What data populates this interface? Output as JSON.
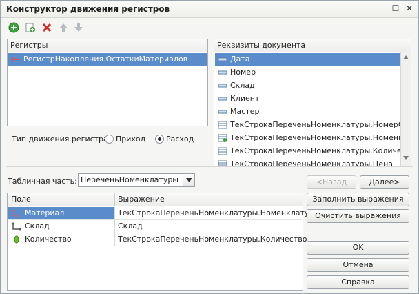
{
  "window": {
    "title": "Конструктор движения регистров",
    "restore_glyph": "☐",
    "close_glyph": "✕"
  },
  "toolbar": {
    "icons": [
      "add-icon",
      "copy-add-icon",
      "delete-icon",
      "move-up-icon",
      "move-down-icon"
    ]
  },
  "registers": {
    "header": "Регистры",
    "items": [
      "РегистрНакопления.ОстаткиМатериалов"
    ]
  },
  "attributes": {
    "header": "Реквизиты документа",
    "items": [
      "Дата",
      "Номер",
      "Склад",
      "Клиент",
      "Мастер",
      "ТекСтрокаПереченьНоменклатуры.НомерСт...",
      "ТекСтрокаПереченьНоменклатуры.Номенкл...",
      "ТекСтрокаПереченьНоменклатуры.Количест...",
      "ТекСтрокаПереченьНоменклатуры.Цена"
    ],
    "selected_index": 0
  },
  "movement": {
    "label": "Тип движения регистра:",
    "options": [
      "Приход",
      "Расход"
    ],
    "selected": "Расход"
  },
  "table_part": {
    "label": "Табличная часть:",
    "value": "ПереченьНоменклатуры"
  },
  "nav": {
    "back": "<Назад",
    "next": "Далее>"
  },
  "fields_grid": {
    "columns": [
      "Поле",
      "Выражение"
    ],
    "rows": [
      {
        "field": "Материал",
        "expression": "ТекСтрокаПереченьНоменклатуры.Номенклатура",
        "icon": "dimension-icon"
      },
      {
        "field": "Склад",
        "expression": "Склад",
        "icon": "dimension-icon"
      },
      {
        "field": "Количество",
        "expression": "ТекСтрокаПереченьНоменклатуры.Количество",
        "icon": "resource-icon"
      }
    ],
    "selected_index": 0
  },
  "actions": {
    "fill": "Заполнить выражения",
    "clear": "Очистить выражения",
    "ok": "OK",
    "cancel": "Отмена",
    "help": "Справка"
  }
}
